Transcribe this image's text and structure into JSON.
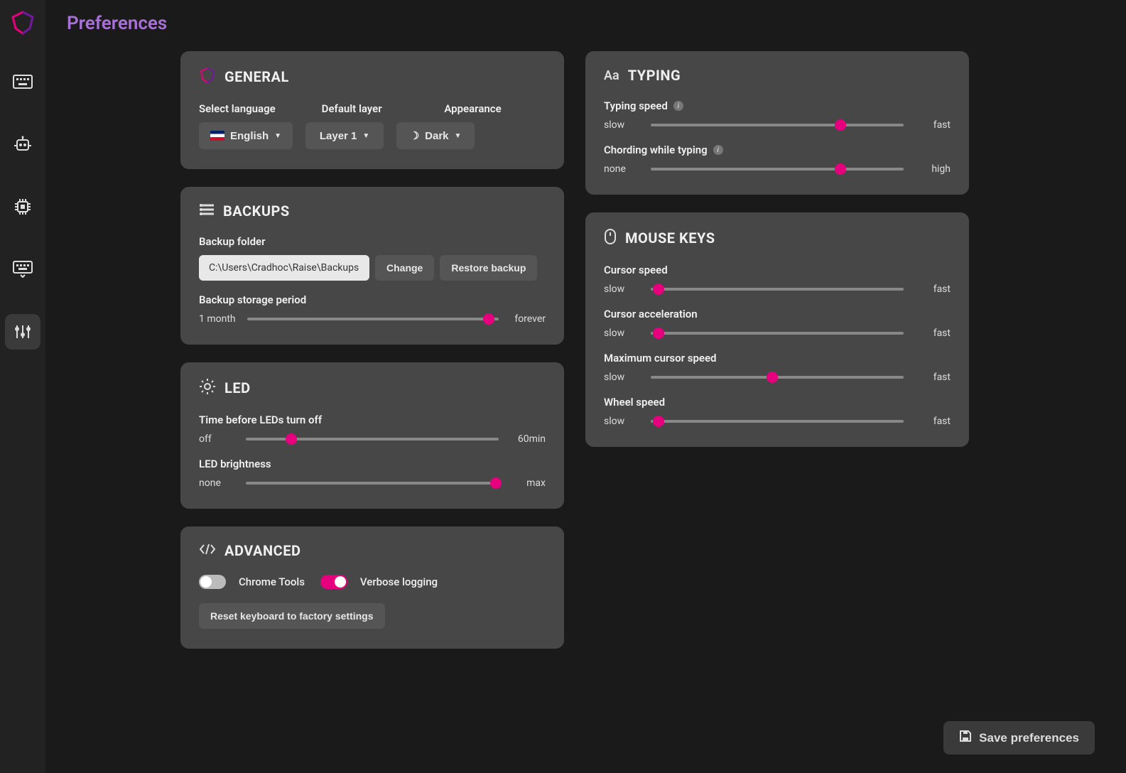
{
  "page": {
    "title": "Preferences"
  },
  "general": {
    "title": "GENERAL",
    "labels": {
      "language": "Select language",
      "layer": "Default layer",
      "appearance": "Appearance"
    },
    "values": {
      "language": "English",
      "layer": "Layer 1",
      "appearance": "Dark"
    }
  },
  "backups": {
    "title": "BACKUPS",
    "folder_label": "Backup folder",
    "folder_value": "C:\\Users\\Cradhoc\\Raise\\Backups",
    "change_label": "Change",
    "restore_label": "Restore backup",
    "storage_label": "Backup storage period",
    "storage_min": "1 month",
    "storage_max": "forever",
    "storage_pct": 96
  },
  "led": {
    "title": "LED",
    "off_label": "Time before LEDs turn off",
    "off_min": "off",
    "off_max": "60min",
    "off_pct": 18,
    "bright_label": "LED brightness",
    "bright_min": "none",
    "bright_max": "max",
    "bright_pct": 99
  },
  "advanced": {
    "title": "ADVANCED",
    "chrome_label": "Chrome Tools",
    "chrome_on": false,
    "verbose_label": "Verbose logging",
    "verbose_on": true,
    "reset_label": "Reset keyboard to factory settings"
  },
  "typing": {
    "title": "TYPING",
    "speed_label": "Typing speed",
    "speed_min": "slow",
    "speed_max": "fast",
    "speed_pct": 75,
    "chord_label": "Chording while typing",
    "chord_min": "none",
    "chord_max": "high",
    "chord_pct": 75
  },
  "mouse": {
    "title": "MOUSE KEYS",
    "cursor_label": "Cursor speed",
    "cursor_pct": 3,
    "accel_label": "Cursor acceleration",
    "accel_pct": 3,
    "max_label": "Maximum cursor speed",
    "max_pct": 48,
    "wheel_label": "Wheel speed",
    "wheel_pct": 3,
    "slow": "slow",
    "fast": "fast"
  },
  "save": {
    "label": "Save preferences"
  }
}
